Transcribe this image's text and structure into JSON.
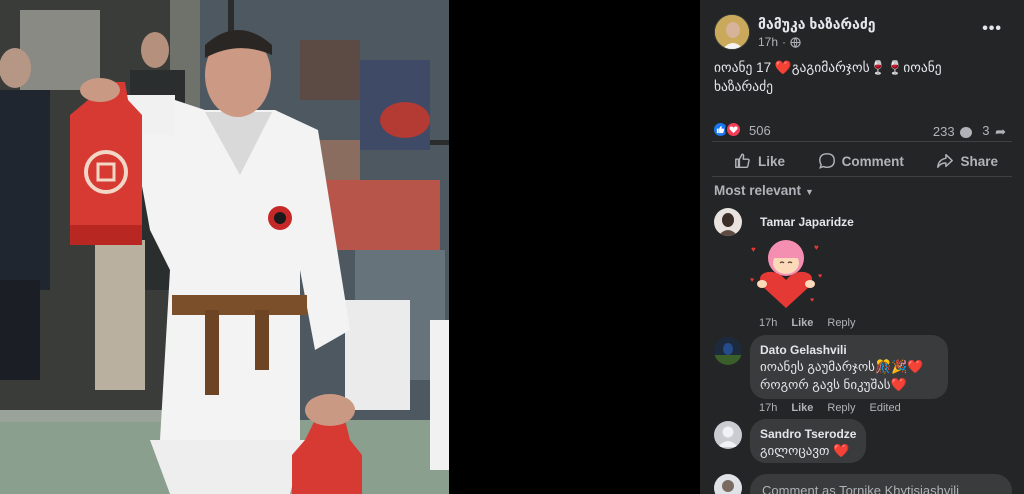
{
  "post": {
    "author": "მამუკა ხაზარაძე",
    "time": "17h",
    "audience_icon": "globe-icon",
    "caption_line1": "იოანე 17 ❤️გაგიმარჯოს🍷🍷იოანე",
    "caption_line2": "ხაზარაძე",
    "more_icon": "more-horizontal-icon",
    "more_label": "•••"
  },
  "reactions": {
    "count": "506",
    "comments_count": "233",
    "shares_count": "3"
  },
  "actions": {
    "like": "Like",
    "comment": "Comment",
    "share": "Share"
  },
  "sort": {
    "label": "Most relevant"
  },
  "comments": [
    {
      "name": "Tamar Japaridze",
      "sticker": "heart-hug-sticker",
      "time": "17h",
      "like": "Like",
      "reply": "Reply"
    },
    {
      "name": "Dato Gelashvili",
      "line1": "იოანეს გაუმარჯოს🎊🎉❤️",
      "line2": "როგორ გავს ნიკუშას❤️",
      "time": "17h",
      "like": "Like",
      "reply": "Reply",
      "edited": "Edited"
    },
    {
      "name": "Sandro Tserodze",
      "line1": "გილოცავთ ❤️",
      "time": "",
      "like": "",
      "reply": ""
    }
  ],
  "composer": {
    "placeholder": "Comment as Tornike Khytisiashvili"
  },
  "colors": {
    "panel_bg": "#242526",
    "bubble_bg": "#3a3b3c",
    "like_blue": "#1877f2",
    "love_red": "#f33e58"
  }
}
